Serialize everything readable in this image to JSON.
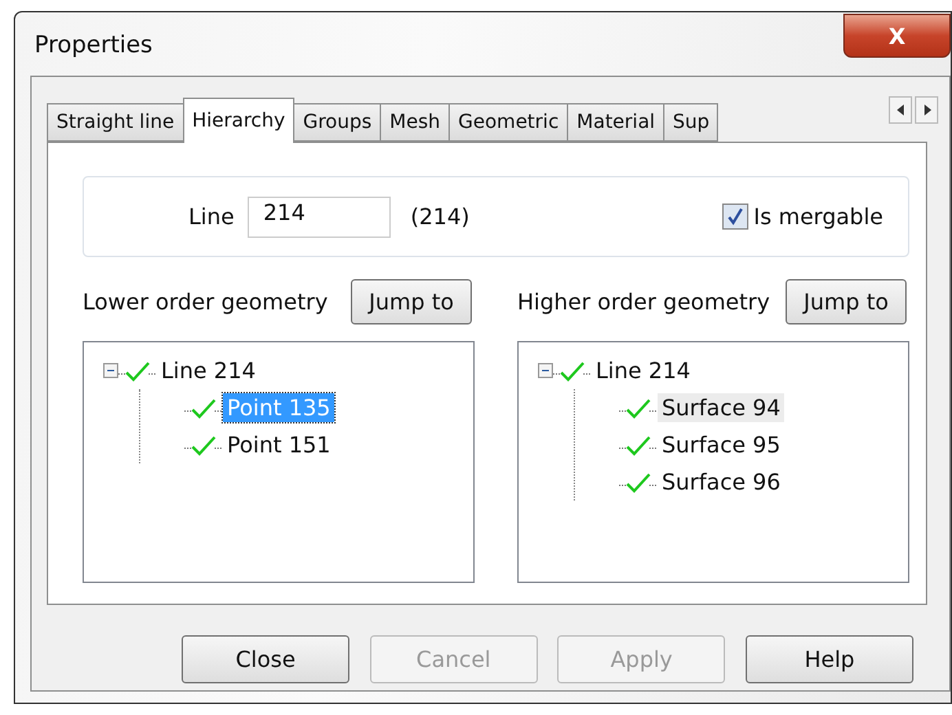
{
  "window": {
    "title": "Properties",
    "close_label": "X"
  },
  "tabs": [
    {
      "label": "Straight line",
      "selected": false
    },
    {
      "label": "Hierarchy",
      "selected": true
    },
    {
      "label": "Groups",
      "selected": false
    },
    {
      "label": "Mesh",
      "selected": false
    },
    {
      "label": "Geometric",
      "selected": false
    },
    {
      "label": "Material",
      "selected": false
    },
    {
      "label": "Sup",
      "selected": false
    }
  ],
  "entity": {
    "label": "Line",
    "value": "214",
    "id": "(214)",
    "mergable": {
      "label": "Is mergable",
      "checked": true
    }
  },
  "panes": [
    {
      "label": "Lower order geometry",
      "button": "Jump to",
      "tree": [
        {
          "label": "Line 214",
          "expanded": true,
          "selected": false,
          "hover": false,
          "children": [
            {
              "label": "Point 135",
              "selected": true,
              "hover": false
            },
            {
              "label": "Point 151",
              "selected": false,
              "hover": false
            }
          ]
        }
      ]
    },
    {
      "label": "Higher order geometry",
      "button": "Jump to",
      "tree": [
        {
          "label": "Line 214",
          "expanded": true,
          "selected": false,
          "hover": false,
          "children": [
            {
              "label": "Surface 94",
              "selected": false,
              "hover": true
            },
            {
              "label": "Surface 95",
              "selected": false,
              "hover": false
            },
            {
              "label": "Surface 96",
              "selected": false,
              "hover": false
            }
          ]
        }
      ]
    }
  ],
  "buttons": [
    {
      "label": "Close",
      "disabled": false
    },
    {
      "label": "Cancel",
      "disabled": true
    },
    {
      "label": "Apply",
      "disabled": true
    },
    {
      "label": "Help",
      "disabled": false
    }
  ]
}
